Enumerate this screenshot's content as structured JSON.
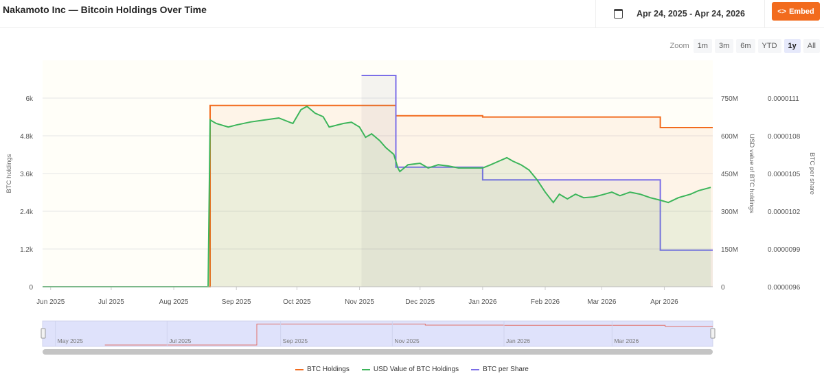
{
  "header": {
    "title": "Nakamoto Inc — Bitcoin Holdings Over Time",
    "date_range": "Apr 24, 2025 - Apr 24, 2026",
    "embed_label": "Embed",
    "calendar_icon": "calendar-icon",
    "embed_icon": "code-icon"
  },
  "zoom": {
    "label": "Zoom",
    "options": [
      "1m",
      "3m",
      "6m",
      "YTD",
      "1y",
      "All"
    ],
    "selected": "1y"
  },
  "colors": {
    "btc_holdings": "#f26b1d",
    "usd_value": "#3cb55a",
    "btc_per_share": "#7b6ee8",
    "embed": "#f26b1d"
  },
  "chart_data": {
    "type": "line",
    "x_range": [
      "2025-05-28",
      "2026-04-25"
    ],
    "x_ticks": [
      "Jun 2025",
      "Jul 2025",
      "Aug 2025",
      "Sep 2025",
      "Oct 2025",
      "Nov 2025",
      "Dec 2025",
      "Jan 2026",
      "Feb 2026",
      "Mar 2026",
      "Apr 2026"
    ],
    "x_tick_dates": [
      "2025-06-01",
      "2025-07-01",
      "2025-08-01",
      "2025-09-01",
      "2025-10-01",
      "2025-11-01",
      "2025-12-01",
      "2026-01-01",
      "2026-02-01",
      "2026-03-01",
      "2026-04-01"
    ],
    "y_left": {
      "label": "BTC holdings",
      "range": [
        0,
        7200
      ],
      "ticks": [
        "0",
        "1.2k",
        "2.4k",
        "3.6k",
        "4.8k",
        "6k"
      ]
    },
    "y_right1": {
      "label": "USD value of BTC holdings",
      "range": [
        0,
        900
      ],
      "unit": "M",
      "ticks": [
        "0",
        "150M",
        "300M",
        "450M",
        "600M",
        "750M"
      ]
    },
    "y_right2": {
      "label": "BTC per share",
      "range": [
        9.6e-06,
        1.14e-05
      ],
      "ticks": [
        "0.0000096",
        "0.0000099",
        "0.0000102",
        "0.0000105",
        "0.0000108",
        "0.0000111"
      ]
    },
    "grid": true,
    "legend_placement": "bottom",
    "series": [
      {
        "name": "BTC Holdings",
        "axis": "left",
        "step": true,
        "points": [
          [
            "2025-05-28",
            0
          ],
          [
            "2025-08-19",
            5765
          ],
          [
            "2025-11-19",
            5440
          ],
          [
            "2026-01-01",
            5398
          ],
          [
            "2026-03-30",
            5062
          ],
          [
            "2026-04-25",
            5062
          ]
        ]
      },
      {
        "name": "USD Value of BTC Holdings",
        "axis": "right1",
        "points": [
          [
            "2025-05-28",
            0
          ],
          [
            "2025-08-18",
            0
          ],
          [
            "2025-08-19",
            663
          ],
          [
            "2025-08-22",
            649
          ],
          [
            "2025-08-28",
            635
          ],
          [
            "2025-09-01",
            643
          ],
          [
            "2025-09-08",
            655
          ],
          [
            "2025-09-15",
            663
          ],
          [
            "2025-09-22",
            671
          ],
          [
            "2025-09-29",
            649
          ],
          [
            "2025-10-03",
            704
          ],
          [
            "2025-10-06",
            717
          ],
          [
            "2025-10-10",
            690
          ],
          [
            "2025-10-14",
            676
          ],
          [
            "2025-10-17",
            635
          ],
          [
            "2025-10-24",
            649
          ],
          [
            "2025-10-28",
            654
          ],
          [
            "2025-11-01",
            635
          ],
          [
            "2025-11-04",
            594
          ],
          [
            "2025-11-07",
            608
          ],
          [
            "2025-11-11",
            581
          ],
          [
            "2025-11-14",
            553
          ],
          [
            "2025-11-18",
            526
          ],
          [
            "2025-11-20",
            472
          ],
          [
            "2025-11-21",
            458
          ],
          [
            "2025-11-25",
            485
          ],
          [
            "2025-12-01",
            491
          ],
          [
            "2025-12-05",
            472
          ],
          [
            "2025-12-10",
            485
          ],
          [
            "2025-12-15",
            480
          ],
          [
            "2025-12-20",
            472
          ],
          [
            "2025-12-26",
            472
          ],
          [
            "2026-01-01",
            472
          ],
          [
            "2026-01-05",
            485
          ],
          [
            "2026-01-09",
            499
          ],
          [
            "2026-01-13",
            513
          ],
          [
            "2026-01-16",
            499
          ],
          [
            "2026-01-20",
            485
          ],
          [
            "2026-01-24",
            464
          ],
          [
            "2026-01-28",
            425
          ],
          [
            "2026-02-01",
            376
          ],
          [
            "2026-02-05",
            335
          ],
          [
            "2026-02-08",
            368
          ],
          [
            "2026-02-12",
            349
          ],
          [
            "2026-02-16",
            368
          ],
          [
            "2026-02-20",
            354
          ],
          [
            "2026-02-25",
            357
          ],
          [
            "2026-03-01",
            365
          ],
          [
            "2026-03-06",
            376
          ],
          [
            "2026-03-10",
            362
          ],
          [
            "2026-03-15",
            376
          ],
          [
            "2026-03-20",
            368
          ],
          [
            "2026-03-25",
            354
          ],
          [
            "2026-03-30",
            344
          ],
          [
            "2026-04-03",
            335
          ],
          [
            "2026-04-08",
            354
          ],
          [
            "2026-04-14",
            368
          ],
          [
            "2026-04-18",
            382
          ],
          [
            "2026-04-24",
            395
          ]
        ]
      },
      {
        "name": "BTC per Share",
        "axis": "right2",
        "step": true,
        "points": [
          [
            "2025-11-02",
            1.128e-05
          ],
          [
            "2025-11-19",
            1.055e-05
          ],
          [
            "2026-01-01",
            1.045e-05
          ],
          [
            "2026-03-30",
            9.89e-06
          ],
          [
            "2026-04-25",
            9.89e-06
          ]
        ]
      }
    ],
    "navigator": {
      "range": [
        "2025-04-24",
        "2026-04-25"
      ],
      "ticks": [
        "May 2025",
        "Jul 2025",
        "Sep 2025",
        "Nov 2025",
        "Jan 2026",
        "Mar 2026"
      ],
      "tick_dates": [
        "2025-05-01",
        "2025-07-01",
        "2025-09-01",
        "2025-11-01",
        "2026-01-01",
        "2026-03-01"
      ]
    }
  }
}
